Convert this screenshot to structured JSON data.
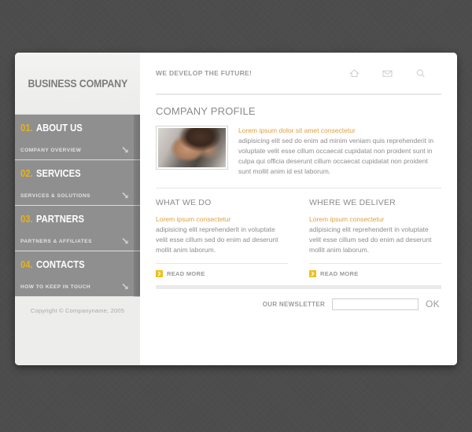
{
  "site": {
    "logo": "BUSINESS COMPANY",
    "tagline": "WE DEVELOP THE FUTURE!",
    "copyright": "Copyright © Companyname, 2005"
  },
  "colors": {
    "accent_yellow": "#E6B316",
    "readmore_yellow": "#EFC01C",
    "lead_orange": "#E0A03C",
    "sidebar_nav_gray": "#8F8F8F",
    "sidebar_bg": "#EDEDEC",
    "body_text_gray": "#8D8D8D",
    "page_background": "#4A4A4A"
  },
  "top_icons": [
    {
      "name": "home-icon",
      "label": "Home"
    },
    {
      "name": "mail-icon",
      "label": "Mail"
    },
    {
      "name": "search-icon",
      "label": "Search"
    }
  ],
  "nav": [
    {
      "number": "01.",
      "label": "ABOUT US",
      "sublabel": "COMPANY OVERVIEW"
    },
    {
      "number": "02.",
      "label": "SERVICES",
      "sublabel": "SERVICES & SOLUTIONS"
    },
    {
      "number": "03.",
      "label": "PARTNERS",
      "sublabel": "PARTNERS & AFFILIATES"
    },
    {
      "number": "04.",
      "label": "CONTACTS",
      "sublabel": "HOW TO KEEP IN TOUCH"
    }
  ],
  "profile": {
    "title": "COMPANY PROFILE",
    "image_alt": "businessman-on-phone-photo",
    "lead": "Lorem ipsum dolor sit amet consectetur",
    "body": "adipisicing elit sed do enim ad minim veniam quis  reprehenderit in voluptate velit esse cillum occaecat cupidatat non proident sunt in culpa qui officia deserunt cillum occaecat cupidatat non proident sunt mollit anim id est laborum."
  },
  "columns": [
    {
      "title": "WHAT WE DO",
      "lead": "Lorem ipsum consectetur",
      "body": "adipisicing elit reprehenderit in voluptate velit esse cillum sed do enim ad deserunt mollit anim laborum.",
      "readmore": "READ MORE"
    },
    {
      "title": "WHERE WE DELIVER",
      "lead": "Lorem ipsum consectetur",
      "body": "adipisicing elit reprehenderit in voluptate velit esse cillum sed do enim ad deserunt mollit anim laborum.",
      "readmore": "READ MORE"
    }
  ],
  "newsletter": {
    "label": "OUR NEWSLETTER",
    "value": "",
    "placeholder": "",
    "submit": "OK"
  }
}
